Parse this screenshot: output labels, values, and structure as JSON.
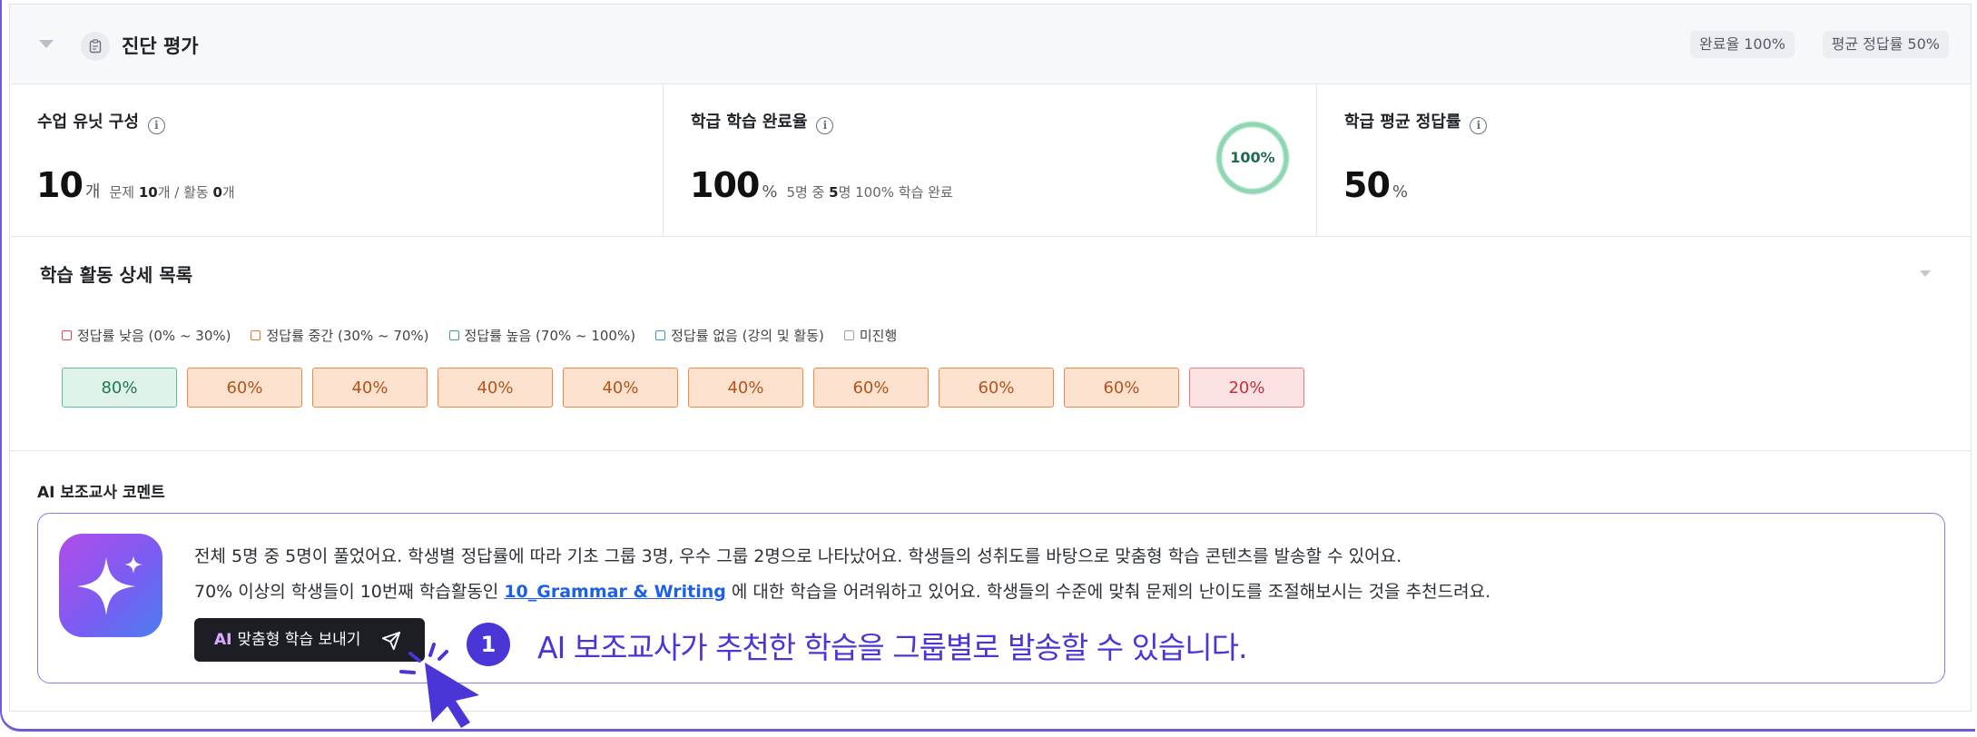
{
  "header": {
    "title": "진단 평가",
    "badges": [
      "완료율 100%",
      "평균 정답률 50%"
    ]
  },
  "stats": [
    {
      "label": "수업 유닛 구성",
      "value": "10",
      "unit": "개",
      "sub_prefix": "문제 ",
      "sub_num1": "10",
      "sub_mid": "개 / 활동 ",
      "sub_num2": "0",
      "sub_suffix": "개"
    },
    {
      "label": "학급 학습 완료율",
      "value": "100",
      "unit": "%",
      "sub_prefix": "5명 중 ",
      "sub_num1": "5",
      "sub_mid": "명 100% 학습 완료",
      "ring_label": "100%",
      "ring_fraction": 1.0
    },
    {
      "label": "학급 평균 정답률",
      "value": "50",
      "unit": "%"
    }
  ],
  "activity": {
    "title": "학습 활동 상세 목록",
    "legend": [
      {
        "label": "정답률 낮음 (0% ~ 30%)",
        "color": "#e5484d"
      },
      {
        "label": "정답률 중간 (30% ~ 70%)",
        "color": "#e8772e"
      },
      {
        "label": "정답률 높음 (70% ~ 100%)",
        "color": "#3aa577"
      },
      {
        "label": "정답률 없음 (강의 및 활동)",
        "color": "#3b8fe0"
      },
      {
        "label": "미진행",
        "color": "#9aa1ab"
      }
    ],
    "scores": [
      {
        "label": "80%",
        "level": "high"
      },
      {
        "label": "60%",
        "level": "mid"
      },
      {
        "label": "40%",
        "level": "mid"
      },
      {
        "label": "40%",
        "level": "mid"
      },
      {
        "label": "40%",
        "level": "mid"
      },
      {
        "label": "40%",
        "level": "mid"
      },
      {
        "label": "60%",
        "level": "mid"
      },
      {
        "label": "60%",
        "level": "mid"
      },
      {
        "label": "60%",
        "level": "mid"
      },
      {
        "label": "20%",
        "level": "low"
      }
    ]
  },
  "ai": {
    "title": "AI 보조교사 코멘트",
    "line1": "전체 5명 중 5명이 풀었어요. 학생별 정답률에 따라 기초 그룹 3명, 우수 그룹 2명으로 나타났어요. 학생들의 성취도를 바탕으로 맞춤형 학습 콘텐츠를 발송할 수 있어요.",
    "line2_before": "70% 이상의 학생들이 10번째 학습활동인 ",
    "line2_link": "10_Grammar & Writing",
    "line2_after": " 에 대한 학습을 어려워하고 있어요. 학생들의 수준에 맞춰 문제의 난이도를 조절해보시는 것을 추천드려요.",
    "button_tag": "AI",
    "button_label": "맞춤형 학습 보내기"
  },
  "callout": {
    "number": "1",
    "text": "AI 보조교사가 추천한 학습을 그룹별로 발송할 수 있습니다."
  },
  "colors": {
    "accent": "#4a36d6",
    "low_bg": "#fde2e4",
    "low_border": "#ec7a80",
    "low_text": "#c2323b",
    "mid_bg": "#fde3cf",
    "mid_border": "#ea8a47",
    "mid_text": "#b4531a",
    "high_bg": "#dff3ea",
    "high_border": "#5fbf93",
    "high_text": "#1f7a52"
  }
}
